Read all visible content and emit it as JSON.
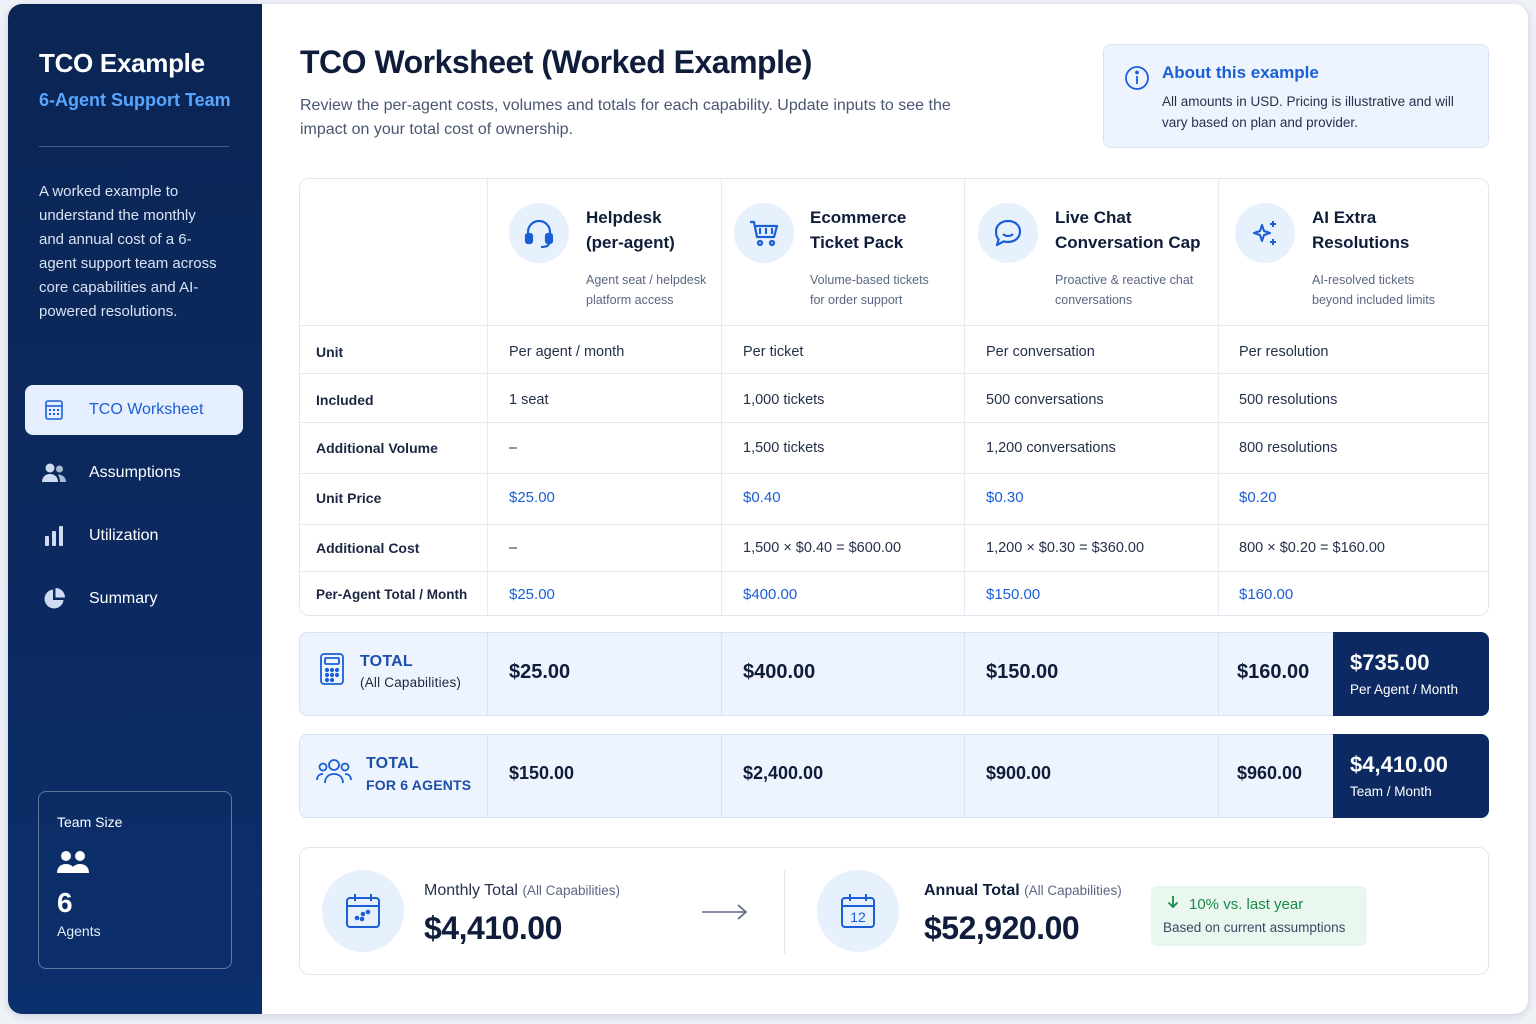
{
  "sidebar": {
    "title": "TCO Example",
    "subtitle": "6-Agent Support Team",
    "description": "A worked example to understand the monthly and annual cost of a 6-agent support team across core capabilities and AI-powered resolutions.",
    "nav": [
      {
        "label": "TCO Worksheet",
        "icon": "calculator-icon",
        "active": true
      },
      {
        "label": "Assumptions",
        "icon": "users-icon"
      },
      {
        "label": "Utilization",
        "icon": "bar-chart-icon"
      },
      {
        "label": "Summary",
        "icon": "pie-chart-icon"
      }
    ],
    "team": {
      "label": "Team Size",
      "value": "6",
      "unit": "Agents"
    }
  },
  "header": {
    "title": "TCO Worksheet (Worked Example)",
    "description": "Review the per-agent costs, volumes and totals for each capability. Update inputs to see the impact on your total cost of ownership."
  },
  "about": {
    "title": "About this example",
    "text": "All amounts in USD. Pricing is illustrative and will vary based on plan and provider."
  },
  "capabilities": [
    {
      "title": "Helpdesk\n(per-agent)",
      "desc": "Agent seat / helpdesk\nplatform access",
      "icon": "headset-icon"
    },
    {
      "title": "Ecommerce\nTicket Pack",
      "desc": "Volume-based tickets\nfor order support",
      "icon": "cart-icon"
    },
    {
      "title": "Live Chat\nConversation Cap",
      "desc": "Proactive & reactive chat\nconversations",
      "icon": "chat-icon"
    },
    {
      "title": "AI Extra\nResolutions",
      "desc": "AI-resolved tickets\nbeyond included limits",
      "icon": "sparkle-icon"
    }
  ],
  "rows": [
    {
      "label": "Unit",
      "values": [
        "Per agent / month",
        "Per ticket",
        "Per conversation",
        "Per resolution"
      ],
      "highlight": false
    },
    {
      "label": "Included",
      "values": [
        "1 seat",
        "1,000 tickets",
        "500 conversations",
        "500 resolutions"
      ],
      "highlight": false
    },
    {
      "label": "Additional Volume",
      "values": [
        "–",
        "1,500 tickets",
        "1,200 conversations",
        "800 resolutions"
      ],
      "highlight": false
    },
    {
      "label": "Unit Price",
      "values": [
        "$25.00",
        "$0.40",
        "$0.30",
        "$0.20"
      ],
      "highlight": true
    },
    {
      "label": "Additional Cost",
      "values": [
        "–",
        "1,500 × $0.40 = $600.00",
        "1,200 × $0.30 = $360.00",
        "800 × $0.20 = $160.00"
      ],
      "highlight": false
    },
    {
      "label": "Per-Agent Total / Month",
      "values": [
        "$25.00",
        "$400.00",
        "$150.00",
        "$160.00"
      ],
      "highlight": true
    }
  ],
  "total_all": {
    "label": "TOTAL",
    "sublabel": "(All Capabilities)",
    "values": [
      "$25.00",
      "$400.00",
      "$150.00",
      "$160.00"
    ],
    "grand": "$735.00",
    "grand_unit": "Per Agent / Month"
  },
  "total_agents": {
    "label": "TOTAL",
    "sublabel": "FOR 6 AGENTS",
    "values": [
      "$150.00",
      "$2,400.00",
      "$900.00",
      "$960.00"
    ],
    "grand": "$4,410.00",
    "grand_unit": "Team / Month"
  },
  "summary": {
    "monthly_label": "Monthly Total",
    "monthly_note": "(All Capabilities)",
    "monthly_value": "$4,410.00",
    "annual_label": "Annual Total",
    "annual_note": "(All Capabilities)",
    "annual_value": "$52,920.00",
    "calendar_day": "12",
    "trend_text": "10% vs. last year",
    "trend_note": "Based on current assumptions"
  },
  "colors": {
    "navy": "#0c2a61",
    "accent": "#1a5fd6",
    "light": "#eef4fd",
    "green": "#1a8a4a"
  }
}
